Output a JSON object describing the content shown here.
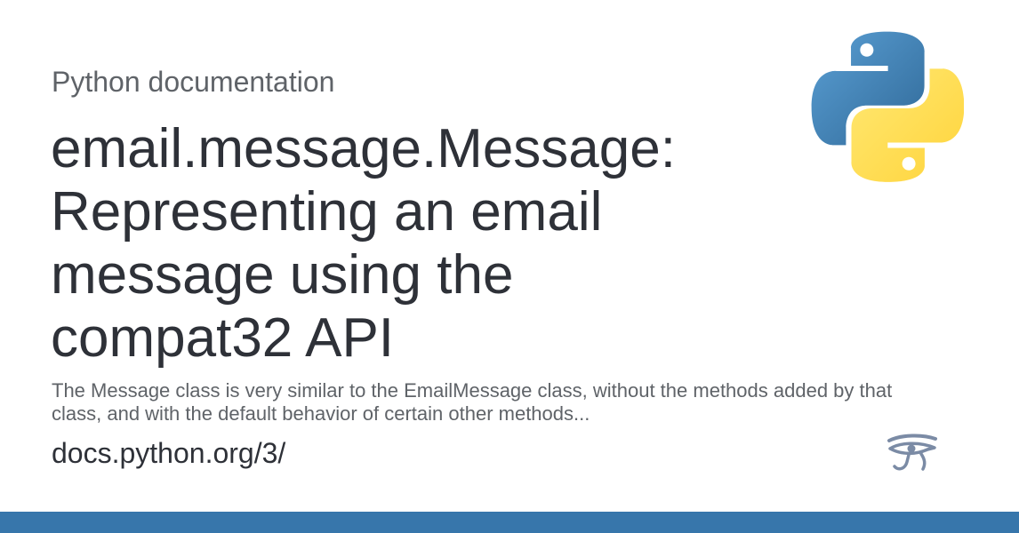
{
  "site_name": "Python documentation",
  "title": "email.message.Message: Representing an email message using the compat32 API",
  "description": "The Message class is very similar to the EmailMessage class, without the methods added by that class, and with the default behavior of certain other methods...",
  "site_url": "docs.python.org/3/",
  "icons": {
    "logo": "python-logo-icon",
    "eye": "eye-of-horus-icon"
  },
  "colors": {
    "bottom_bar": "#3776ab",
    "python_blue": "#3d77aa",
    "python_yellow": "#ffd43b",
    "eye": "#7b8ba5"
  }
}
